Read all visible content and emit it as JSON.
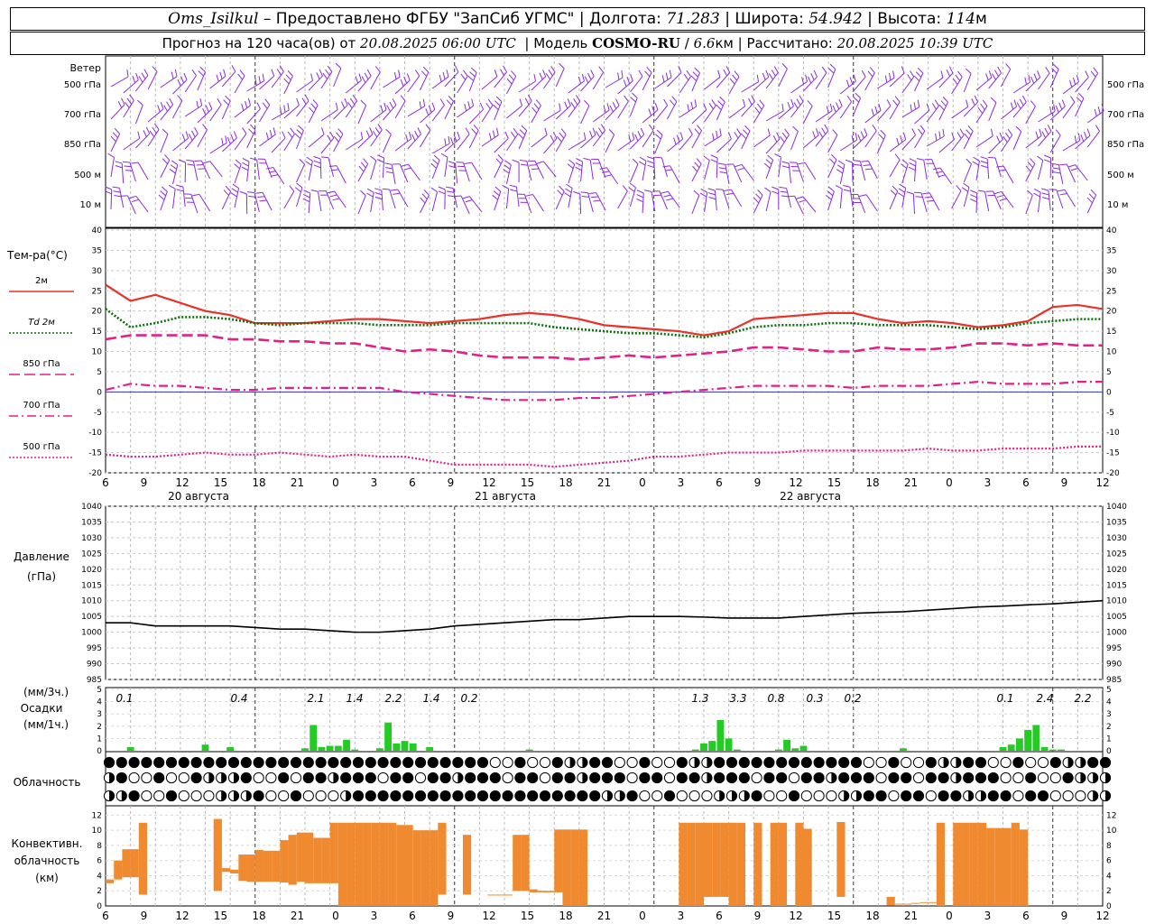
{
  "header": {
    "station": "Oms_Isilkul",
    "dash": "–",
    "provided_by": "Предоставлено ФГБУ \"ЗапСиб УГМС\"",
    "lon_label": "Долгота:",
    "lon_value": "71.283",
    "lat_label": "Широта:",
    "lat_value": "54.942",
    "alt_label": "Высота:",
    "alt_value": "114",
    "alt_unit": "м",
    "sep": "|",
    "forecast_prefix": "Прогноз на 120 часа(ов) от",
    "forecast_start": "20.08.2025 06:00 UTC",
    "model_label": "Модель",
    "model_name": "COSMO-RU",
    "model_slash": "/",
    "model_res": "6.6",
    "model_res_unit": "км",
    "computed_label": "Рассчитано:",
    "computed_value": "20.08.2025 10:39 UTC"
  },
  "wind_panel": {
    "title": "Ветер",
    "levels": [
      "500 гПа",
      "700 гПа",
      "850 гПа",
      "500 м",
      "10  м"
    ]
  },
  "temp_panel": {
    "title": "Тем-ра(°С)",
    "legend": [
      {
        "label": "2м",
        "color": "#e8322a",
        "style": "solid"
      },
      {
        "label": "Td  2м",
        "color": "#0a6e0a",
        "style": "dotted"
      },
      {
        "label": "850 гПа",
        "color": "#e0218a",
        "style": "dashed"
      },
      {
        "label": "700 гПа",
        "color": "#e0218a",
        "style": "dashdot"
      },
      {
        "label": "500 гПа",
        "color": "#e0218a",
        "style": "dotted"
      }
    ]
  },
  "time_axis": {
    "hour_labels": [
      "6",
      "9",
      "12",
      "15",
      "18",
      "21",
      "0",
      "3",
      "6",
      "9",
      "12",
      "15",
      "18",
      "21",
      "0",
      "3",
      "6",
      "9",
      "12",
      "15",
      "18",
      "21",
      "0",
      "3",
      "6",
      "9",
      "12"
    ],
    "date_labels": [
      "20 августа",
      "21 августа",
      "22 августа"
    ]
  },
  "pressure_panel": {
    "title": "Давление",
    "unit": "(гПа)"
  },
  "precip_panel": {
    "unit_3h": "(мм/3ч.)",
    "title": "Осадки",
    "unit_1h": "(мм/1ч.)",
    "sum_labels": [
      "0.1",
      "0.4",
      "2.1",
      "1.4",
      "2.2",
      "1.4",
      "0.2",
      "1.3",
      "3.3",
      "0.8",
      "0.3",
      "0.2",
      "0.1",
      "2.4",
      "2.2"
    ]
  },
  "cloud_panel": {
    "title": "Облачность"
  },
  "conv_panel": {
    "title_line1": "Конвективн.",
    "title_line2": "облачность",
    "unit": "(км)"
  },
  "colors": {
    "wind": "#8a2be2",
    "t2m": "#e8322a",
    "td2m": "#0a6e0a",
    "upper": "#e0218a",
    "pressure": "#000000",
    "precip": "#22cc22",
    "conv": "#f08a30",
    "zero_line": "#3030c0"
  },
  "chart_data": [
    {
      "type": "line",
      "name": "temperature",
      "x_hours": [
        0,
        3,
        6,
        9,
        12,
        15,
        18,
        21,
        24,
        27,
        30,
        33,
        36,
        39,
        42,
        45,
        48,
        51,
        54,
        57,
        60,
        63,
        66,
        69,
        72,
        75,
        78,
        81,
        84,
        87,
        90,
        93,
        96,
        99,
        102,
        105,
        108,
        111,
        114,
        117,
        120
      ],
      "ylim": [
        -20,
        40
      ],
      "yticks": [
        -20,
        -15,
        -10,
        -5,
        0,
        5,
        10,
        15,
        20,
        25,
        30,
        35,
        40
      ],
      "series": [
        {
          "name": "2м",
          "values": [
            26.5,
            22.5,
            24,
            22,
            20,
            19,
            17,
            17,
            17,
            17.5,
            18,
            18,
            17.5,
            17,
            17.5,
            18,
            19,
            19.5,
            19,
            18,
            16.5,
            16,
            15.5,
            15,
            14,
            15,
            18,
            18.5,
            19,
            19.5,
            19.5,
            18,
            17,
            17.5,
            17,
            16,
            16.5,
            17.5,
            21,
            21.5,
            20.5
          ]
        },
        {
          "name": "Td 2м",
          "values": [
            20.5,
            16,
            17,
            18.5,
            18.5,
            18,
            17,
            16.5,
            17,
            17,
            17,
            16.5,
            16.5,
            16.5,
            17,
            17,
            17,
            17,
            16,
            15.5,
            15,
            14.5,
            14.5,
            14,
            13.5,
            14.5,
            16,
            16.5,
            16.5,
            17,
            17,
            16.5,
            16.5,
            16.5,
            16,
            15.5,
            16,
            17,
            17.5,
            18,
            18
          ]
        },
        {
          "name": "850 гПа",
          "values": [
            13,
            14,
            14,
            14,
            14,
            13,
            13,
            12.5,
            12.5,
            12,
            12,
            11,
            10,
            10.5,
            10,
            9,
            8.5,
            8.5,
            8.5,
            8,
            8.5,
            9,
            8.5,
            9,
            9.5,
            10,
            11,
            11,
            10.5,
            10,
            10,
            11,
            10.5,
            10.5,
            11,
            12,
            12,
            11.5,
            12,
            11.5,
            11.5
          ]
        },
        {
          "name": "700 гПа",
          "values": [
            0.5,
            2,
            1.5,
            1.5,
            1,
            0.5,
            0.5,
            1,
            1,
            1,
            1,
            1,
            0,
            -0.5,
            -1,
            -1.5,
            -2,
            -2,
            -2,
            -1.5,
            -1.5,
            -1,
            -0.5,
            0,
            0.5,
            1,
            1.5,
            1.5,
            1.5,
            1.5,
            1,
            1.5,
            1.5,
            1.5,
            2,
            2.5,
            2,
            2,
            2,
            2.5,
            2.5
          ]
        },
        {
          "name": "500 гПа",
          "values": [
            -15.5,
            -16,
            -16,
            -15.5,
            -15,
            -15.5,
            -15.5,
            -15,
            -15.5,
            -16,
            -15.5,
            -16,
            -16,
            -17,
            -18,
            -18,
            -18,
            -18,
            -18.5,
            -18,
            -17.5,
            -17,
            -16,
            -16,
            -15.5,
            -15,
            -15,
            -15,
            -14.5,
            -14.5,
            -14.5,
            -14.5,
            -14.5,
            -14,
            -14.5,
            -14.5,
            -14,
            -14,
            -14,
            -13.5,
            -13.5
          ]
        }
      ]
    },
    {
      "type": "line",
      "name": "pressure",
      "x_hours": [
        0,
        3,
        6,
        9,
        12,
        15,
        18,
        21,
        24,
        27,
        30,
        33,
        36,
        39,
        42,
        45,
        48,
        51,
        54,
        57,
        60,
        63,
        66,
        69,
        72,
        75,
        78,
        81,
        84,
        87,
        90,
        93,
        96,
        99,
        102,
        105,
        108,
        111,
        114,
        117,
        120
      ],
      "ylim": [
        985,
        1040
      ],
      "yticks": [
        985,
        990,
        995,
        1000,
        1005,
        1010,
        1015,
        1020,
        1025,
        1030,
        1035,
        1040
      ],
      "series": [
        {
          "name": "pressure",
          "values": [
            1003,
            1003,
            1002,
            1002,
            1002,
            1002,
            1001.5,
            1001,
            1001,
            1000.5,
            1000,
            1000,
            1000.5,
            1001,
            1002,
            1002.5,
            1003,
            1003.5,
            1004,
            1004,
            1004.5,
            1005,
            1005,
            1005,
            1004.8,
            1004.5,
            1004.5,
            1004.5,
            1005,
            1005.5,
            1006,
            1006.3,
            1006.5,
            1007,
            1007.5,
            1008,
            1008.3,
            1008.7,
            1009,
            1009.5,
            1010
          ]
        }
      ]
    },
    {
      "type": "bar",
      "name": "precipitation",
      "x_hours": [
        3,
        12,
        15,
        24,
        25,
        26,
        27,
        28,
        29,
        30,
        33,
        34,
        35,
        36,
        37,
        39,
        51,
        71,
        72,
        73,
        74,
        75,
        76,
        81,
        82,
        83,
        84,
        96,
        108,
        109,
        110,
        111,
        112,
        113,
        114,
        115
      ],
      "values": [
        0.3,
        0.5,
        0.3,
        0.2,
        2.1,
        0.3,
        0.4,
        0.4,
        0.9,
        0.1,
        0.2,
        2.3,
        0.6,
        0.8,
        0.6,
        0.3,
        0.1,
        0.1,
        0.6,
        0.8,
        2.5,
        1,
        0.1,
        0.1,
        0.9,
        0.2,
        0.4,
        0.2,
        0.3,
        0.5,
        1,
        1.7,
        2.1,
        0.3,
        0.1,
        0.1
      ],
      "ylim": [
        0,
        5
      ],
      "yticks": [
        0,
        1,
        2,
        3,
        4,
        5
      ]
    },
    {
      "type": "bar",
      "name": "convective_cloud",
      "x_hours": [
        0,
        1,
        2,
        3,
        4,
        13,
        14,
        15,
        16,
        17,
        18,
        19,
        20,
        21,
        22,
        23,
        24,
        25,
        26,
        27,
        28,
        29,
        30,
        31,
        32,
        33,
        34,
        35,
        36,
        37,
        38,
        39,
        40,
        43,
        46,
        47,
        48,
        49,
        50,
        51,
        52,
        53,
        54,
        55,
        56,
        57,
        69,
        70,
        71,
        72,
        73,
        74,
        75,
        76,
        78,
        80,
        81,
        83,
        84,
        88,
        94,
        95,
        96,
        97,
        98,
        99,
        100,
        102,
        103,
        104,
        105,
        106,
        107,
        108,
        109,
        110,
        111
      ],
      "bottom": [
        3,
        3.5,
        3.8,
        3.8,
        1.5,
        2,
        4.5,
        4.3,
        3.3,
        3.2,
        3.2,
        3.2,
        3.2,
        3.1,
        2.8,
        3.2,
        3,
        3,
        3,
        3,
        0,
        0,
        0,
        0,
        0,
        0,
        0,
        0,
        0,
        0,
        0,
        0,
        1.5,
        1.5,
        2.2,
        2.2,
        2,
        2,
        2,
        1.8,
        1.8,
        1.8,
        1.8,
        0,
        0,
        0,
        0,
        0,
        0,
        1.2,
        1.2,
        1.2,
        0,
        0,
        0,
        0,
        0,
        0,
        0,
        1.2,
        0.1,
        0.2,
        0.3,
        0.4,
        0.4,
        0.4,
        0,
        0,
        0,
        0,
        0,
        0,
        0,
        0,
        0,
        0
      ],
      "top": [
        3.5,
        6,
        7.5,
        7.5,
        11,
        11.5,
        5,
        4.8,
        6.8,
        6.8,
        7.4,
        7.3,
        7.3,
        8.7,
        9.4,
        9.7,
        9.7,
        9,
        9,
        11,
        11,
        11,
        11,
        11,
        11,
        11,
        11,
        10.7,
        10.7,
        10,
        10,
        10,
        11,
        9.4,
        1.5,
        1.5,
        1.5,
        9.4,
        9.4,
        2.2,
        2,
        2,
        10.1,
        10.1,
        10.1,
        10.1,
        11,
        11,
        11,
        11,
        11,
        11,
        11,
        11,
        11,
        11,
        11,
        11,
        10.2,
        11.1,
        1.2,
        0.3,
        0.3,
        0.4,
        0.5,
        0.5,
        11,
        11,
        11,
        11,
        11,
        10.3,
        10.3,
        10.3,
        11,
        10.1
      ],
      "ylim": [
        0,
        13
      ],
      "yticks": [
        0,
        2,
        4,
        6,
        8,
        10,
        12
      ]
    }
  ]
}
